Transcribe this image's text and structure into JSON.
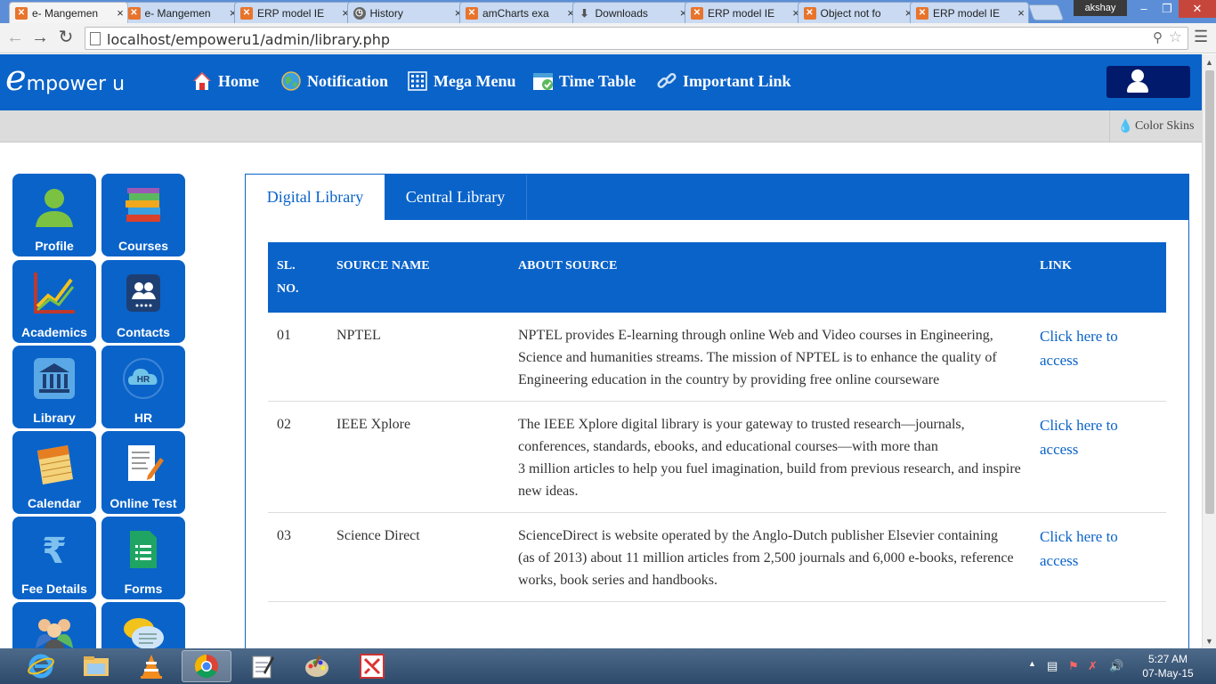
{
  "browser": {
    "tabs": [
      {
        "title": "e- Mangemen",
        "icon": "xampp-icon",
        "active": true
      },
      {
        "title": "e- Mangemen",
        "icon": "xampp-icon"
      },
      {
        "title": "ERP model IE",
        "icon": "xampp-icon"
      },
      {
        "title": "History",
        "icon": "history-icon"
      },
      {
        "title": "amCharts exa",
        "icon": "xampp-icon"
      },
      {
        "title": "Downloads",
        "icon": "download-icon"
      },
      {
        "title": "ERP model IE",
        "icon": "xampp-icon"
      },
      {
        "title": "Object not fo",
        "icon": "xampp-icon"
      },
      {
        "title": "ERP model IE",
        "icon": "xampp-icon"
      }
    ],
    "tab_close": "×",
    "user": "akshay",
    "url": "localhost/empoweru1/admin/library.php"
  },
  "app": {
    "logo_e": "e",
    "logo_text": "mpower u",
    "nav": [
      {
        "label": "Home",
        "icon": "home-icon"
      },
      {
        "label": "Notification",
        "icon": "globe-icon"
      },
      {
        "label": "Mega Menu",
        "icon": "grid-icon"
      },
      {
        "label": "Time Table",
        "icon": "calendar-check-icon"
      },
      {
        "label": "Important Link",
        "icon": "link-icon"
      }
    ],
    "color_skins": "Color Skins"
  },
  "sidebar": {
    "tiles": [
      {
        "label": "Profile",
        "icon": "person-icon"
      },
      {
        "label": "Courses",
        "icon": "books-icon"
      },
      {
        "label": "Academics",
        "icon": "chart-icon"
      },
      {
        "label": "Contacts",
        "icon": "contacts-icon"
      },
      {
        "label": "Library",
        "icon": "library-icon"
      },
      {
        "label": "HR",
        "icon": "hr-cloud-icon"
      },
      {
        "label": "Calendar",
        "icon": "calendar-icon"
      },
      {
        "label": "Online Test",
        "icon": "test-icon"
      },
      {
        "label": "Fee Details",
        "icon": "rupee-icon"
      },
      {
        "label": "Forms",
        "icon": "forms-icon"
      },
      {
        "label": "",
        "icon": "users-icon"
      },
      {
        "label": "",
        "icon": "chat-icon"
      }
    ]
  },
  "library": {
    "tabs": [
      "Digital Library",
      "Central Library"
    ],
    "headers": {
      "sl": "SL. NO.",
      "name": "SOURCE NAME",
      "about": "ABOUT SOURCE",
      "link": "LINK"
    },
    "rows": [
      {
        "sl": "01",
        "name": "NPTEL",
        "about": [
          "NPTEL provides E-learning through online Web and Video courses in Engineering,",
          "Science and humanities streams. The mission of NPTEL is to enhance the quality of",
          "Engineering education in the country by providing free online courseware"
        ],
        "link": "Click here to access"
      },
      {
        "sl": "02",
        "name": "IEEE Xplore",
        "about": [
          "The IEEE Xplore digital library is your gateway to trusted research—journals, conferences, standards, ebooks, and educational courses—with more than",
          "3 million articles to help you fuel imagination, build from previous research, and inspire new ideas."
        ],
        "link": "Click here to access"
      },
      {
        "sl": "03",
        "name": "Science Direct",
        "about": [
          "ScienceDirect is website operated by the Anglo-Dutch publisher Elsevier containing",
          "(as of 2013) about 11 million articles from 2,500 journals and 6,000 e-books, reference works, book series and handbooks."
        ],
        "link": "Click here to access"
      }
    ]
  },
  "taskbar": {
    "apps": [
      "ie-icon",
      "explorer-icon",
      "vlc-icon",
      "chrome-icon",
      "notepad-icon",
      "paint-icon",
      "xampp-icon"
    ],
    "time": "5:27 AM",
    "date": "07-May-15"
  }
}
